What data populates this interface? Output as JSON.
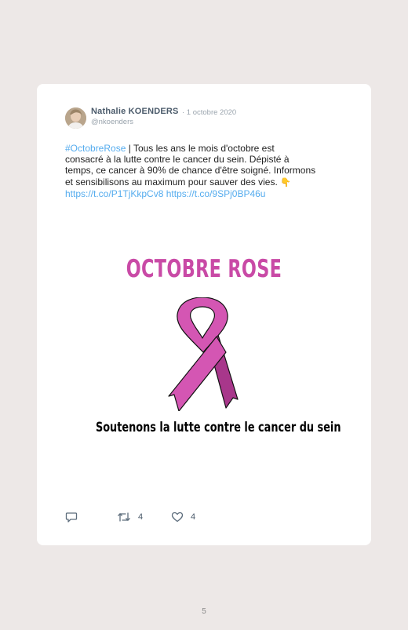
{
  "tweet": {
    "author_name": "Nathalie KOENDERS",
    "date": "· 1 octobre 2020",
    "handle": "@nkoenders",
    "text": {
      "hashtag": "#OctobreRose",
      "line1_rest": " | Tous les ans le mois d'octobre est",
      "line2": "consacré à la lutte contre le cancer du sein. Dépisté à",
      "line3": "temps, ce cancer à 90% de chance d'être soigné. Informons",
      "line4": "et sensibilisons au maximum pour sauver des vies. ",
      "emoji": "👇",
      "link1": "https://t.co/P1TjKkpCv8",
      "link2": "https://t.co/9SPj0BP46u"
    },
    "media": {
      "title": "OCTOBRE ROSE",
      "caption": "Soutenons la lutte contre le cancer du sein",
      "ribbon_color": "#d456b3"
    },
    "actions": {
      "reply_icon": "reply-icon",
      "retweet_icon": "retweet-icon",
      "retweet_count": "4",
      "like_icon": "heart-icon",
      "like_count": "4"
    }
  },
  "page": {
    "number": "5"
  },
  "colors": {
    "background": "#ede8e7",
    "card": "#ffffff",
    "link": "#55acee",
    "title_pink": "#c94aa6"
  }
}
